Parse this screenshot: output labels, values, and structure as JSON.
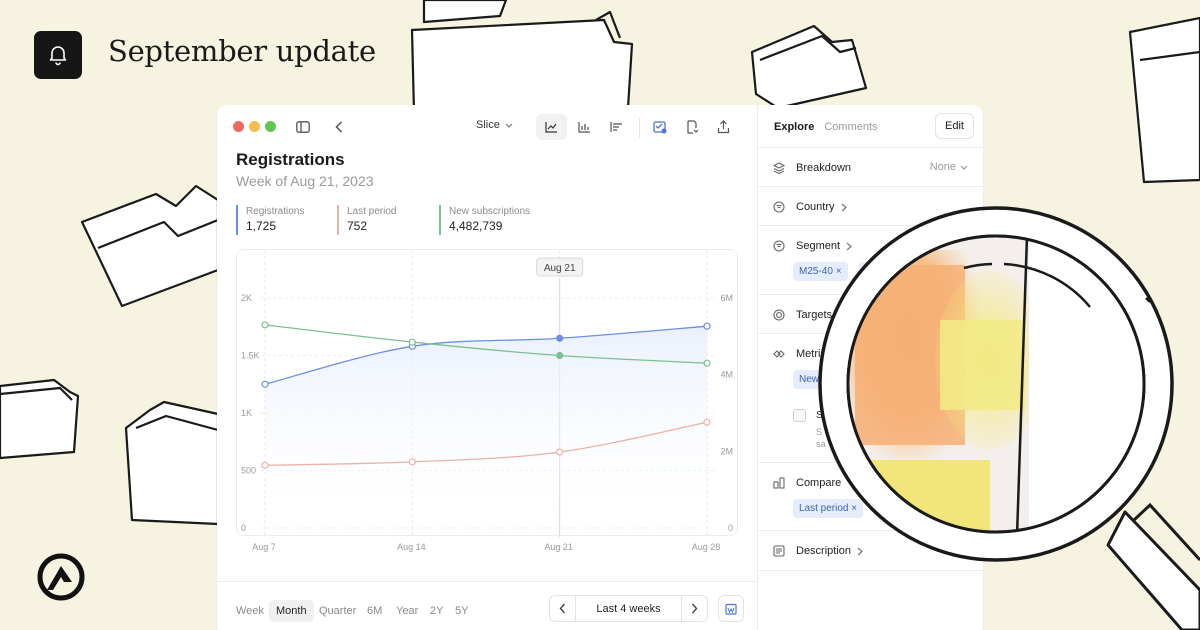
{
  "header": {
    "headline": "September update",
    "bell_icon": "bell-icon",
    "logo_icon": "brand-logo-icon"
  },
  "window": {
    "traffic_lights": [
      "#ec6a5e",
      "#f4be4f",
      "#61c554"
    ],
    "toolbar": {
      "slice_label": "Slice",
      "icons": [
        "sidebar-toggle-icon",
        "back-chevron-icon",
        "line-chart-icon",
        "bar-chart-icon",
        "list-chart-icon",
        "calendar-check-icon",
        "export-doc-icon",
        "share-icon"
      ]
    },
    "title": "Registrations",
    "subtitle": "Week of Aug 21, 2023",
    "metrics": [
      {
        "label": "Registrations",
        "value": "1,725",
        "color": "#6b8fe0"
      },
      {
        "label": "Last period",
        "value": "752",
        "color": "#eab2a6"
      },
      {
        "label": "New subscriptions",
        "value": "4,482,739",
        "color": "#7cc08f"
      }
    ],
    "footer": {
      "periods": [
        "Week",
        "Month",
        "Quarter",
        "6M",
        "Year",
        "2Y",
        "5Y"
      ],
      "selected_period": "Month",
      "range_label": "Last 4 weeks"
    },
    "side_panel": {
      "tabs": [
        "Explore",
        "Comments"
      ],
      "edit_label": "Edit",
      "breakdown_label": "Breakdown",
      "breakdown_value": "None",
      "country_label": "Country",
      "segment_label": "Segment",
      "segment_chip": "M25-40",
      "targets_label": "Targets",
      "metrics_label_visible": "Metric",
      "metrics_chip_visible": "New",
      "checkbox_label_visible": "S",
      "checkbox_sub_visible_1": "S",
      "checkbox_sub_visible_2": "sa",
      "compare_label": "Compare",
      "compare_chip": "Last period",
      "description_label": "Description"
    }
  },
  "chart_data": {
    "type": "line",
    "x": [
      "Aug 7",
      "Aug 14",
      "Aug 21",
      "Aug 28"
    ],
    "tooltip_label": "Aug 21",
    "left_axis": {
      "ticks": [
        "0",
        "500",
        "1K",
        "1.5K",
        "2K"
      ],
      "ylim": [
        0,
        2000
      ]
    },
    "right_axis": {
      "ticks": [
        "0",
        "2M",
        "4M",
        "6M"
      ],
      "ylim": [
        0,
        6000000
      ]
    },
    "grid": true,
    "series": [
      {
        "name": "Registrations",
        "axis": "left",
        "color": "#6b8fe0",
        "values": [
          1250,
          1580,
          1650,
          1755
        ]
      },
      {
        "name": "Last period",
        "axis": "left",
        "color": "#eab2a6",
        "values": [
          545,
          575,
          660,
          920
        ]
      },
      {
        "name": "New subscriptions",
        "axis": "right",
        "color": "#7cc08f",
        "values": [
          5300000,
          4850000,
          4500000,
          4300000
        ]
      }
    ]
  }
}
